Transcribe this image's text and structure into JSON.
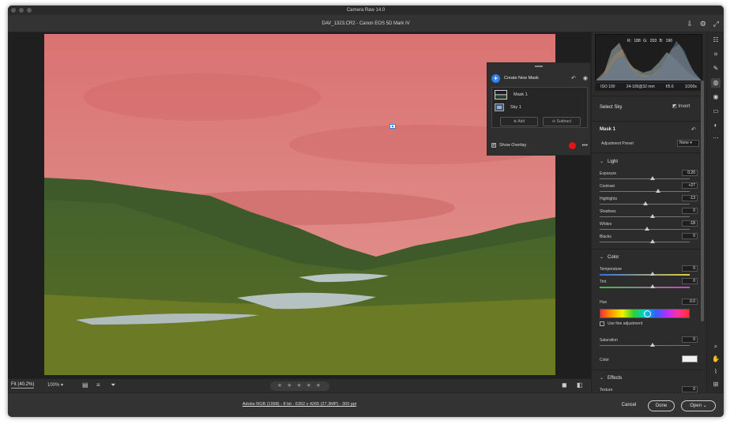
{
  "window": {
    "title": "Camera Raw 14.0",
    "file_title": "DAV_1323.CR2  -  Canon EOS 5D Mark IV"
  },
  "colors": {
    "mask_overlay": "#e31414",
    "accent": "#2f80ed"
  },
  "mask_panel": {
    "create_label": "Create New Mask",
    "masks": [
      "Mask 1",
      "Sky 1"
    ],
    "add_label": "Add",
    "subtract_label": "Subtract",
    "show_overlay_label": "Show Overlay"
  },
  "histogram": {
    "readout": "R: 188   G: 203   B: 196"
  },
  "exif": [
    "ISO 100",
    "24-105@32 mm",
    "f/5.6",
    "1/200s"
  ],
  "right_panel": {
    "select_title": "Select Sky",
    "invert_label": "Invert",
    "mask_name": "Mask 1",
    "preset_label": "Adjustment Preset",
    "preset_value": "None",
    "light_header": "Light",
    "light": [
      {
        "label": "Exposure",
        "value": "0.20"
      },
      {
        "label": "Contrast",
        "value": "+27"
      },
      {
        "label": "Highlights",
        "value": "-13"
      },
      {
        "label": "Shadows",
        "value": "0"
      },
      {
        "label": "Whites",
        "value": "-18"
      },
      {
        "label": "Blacks",
        "value": "0"
      }
    ],
    "color_header": "Color",
    "temperature": {
      "label": "Temperature",
      "value": "0"
    },
    "tint": {
      "label": "Tint",
      "value": "0"
    },
    "hue": {
      "label": "Hue",
      "value": "0.0"
    },
    "fine_label": "Use fine adjustment",
    "saturation": {
      "label": "Saturation",
      "value": "0"
    },
    "color_label": "Color",
    "effects_header": "Effects",
    "texture": {
      "label": "Texture",
      "value": "0"
    }
  },
  "bottom_bar": {
    "fit": "Fit (40.2%)",
    "zoom": "100%",
    "stars": "★ ★ ★ ★ ★"
  },
  "footer": {
    "info": "Adobe RGB (1998) - 8 bit - 6392 x 4265 (27.3MP) - 300 ppi",
    "cancel": "Cancel",
    "done": "Done",
    "open": "Open"
  }
}
